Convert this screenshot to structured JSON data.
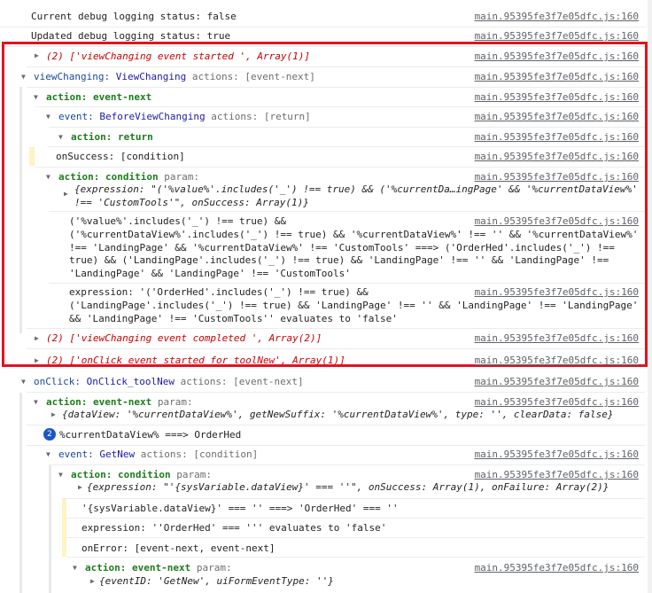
{
  "source": "main.95395fe3f7e05dfc.js:160",
  "lines": {
    "debug_current": "Current debug logging status: false",
    "debug_updated": "Updated debug logging status: true",
    "vc_started": "(2) ['viewChanging event started ', Array(1)]",
    "vc_group_name": "viewChanging:",
    "vc_group_val": "ViewChanging",
    "vc_group_actions": "actions: [event-next]",
    "action_event_next": "action: event-next",
    "event_bvc_label": "event:",
    "event_bvc_val": "BeforeViewChanging",
    "event_bvc_actions": "actions: [return]",
    "action_return": "action: return",
    "onsuccess": "onSuccess:  [condition]",
    "action_condition": "action: condition",
    "action_condition_param": "param:",
    "expr_obj_1": "{expression: \"('%value%'.includes('_') !== true) && ('%currentDa…ingPage' && '%currentDataView%'",
    "expr_obj_2": "!== 'CustomTools'\", onSuccess: Array(1)}",
    "cond_text": "('%value%'.includes('_') !== true) &&\n('%currentDataView%'.includes('_') !== true) && '%currentDataView%' !== '' && '%currentDataView%'\n!== 'LandingPage' && '%currentDataView%' !== 'CustomTools' ===> ('OrderHed'.includes('_') !==\ntrue) && ('LandingPage'.includes('_') !== true) && 'LandingPage' !== '' && 'LandingPage' !==\n'LandingPage' && 'LandingPage' !== 'CustomTools'",
    "expr_text": "expression: '('OrderHed'.includes('_') !== true) &&\n('LandingPage'.includes('_') !== true) && 'LandingPage' !== '' && 'LandingPage' !== 'LandingPage'\n&& 'LandingPage' !== 'CustomTools'' evaluates to 'false'",
    "vc_completed": "(2) ['viewChanging event completed ', Array(2)]",
    "onclick_started": "(2) ['onClick event started for toolNew', Array(1)]",
    "onclick_group_name": "onClick:",
    "onclick_group_val": "OnClick_toolNew",
    "onclick_group_actions": "actions: [event-next]",
    "action_event_next_param": "action: event-next",
    "param_label": "param:",
    "event_next_obj": "{dataView: '%currentDataView%', getNewSuffix: '%currentDataView%', type: '', clearData: false}",
    "badge_count": "2",
    "badge_text": "%currentDataView% ===> OrderHed",
    "event_getnew_label": "event:",
    "event_getnew_val": "GetNew",
    "event_getnew_actions": "actions: [condition]",
    "action_condition2": "action: condition",
    "cond2_obj": "{expression: \"'{sysVariable.dataView}' === ''\", onSuccess: Array(1), onFailure: Array(2)}",
    "cond2_eval": "'{sysVariable.dataView}' === '' ===> 'OrderHed' === ''",
    "cond2_expr": "expression: ''OrderHed' === ''' evaluates to 'false'",
    "onerror": "onError:  [event-next, event-next]",
    "action_event_next3": "action: event-next",
    "event_next3_obj": "{eventID: 'GetNew', uiFormEventType: ''}"
  }
}
